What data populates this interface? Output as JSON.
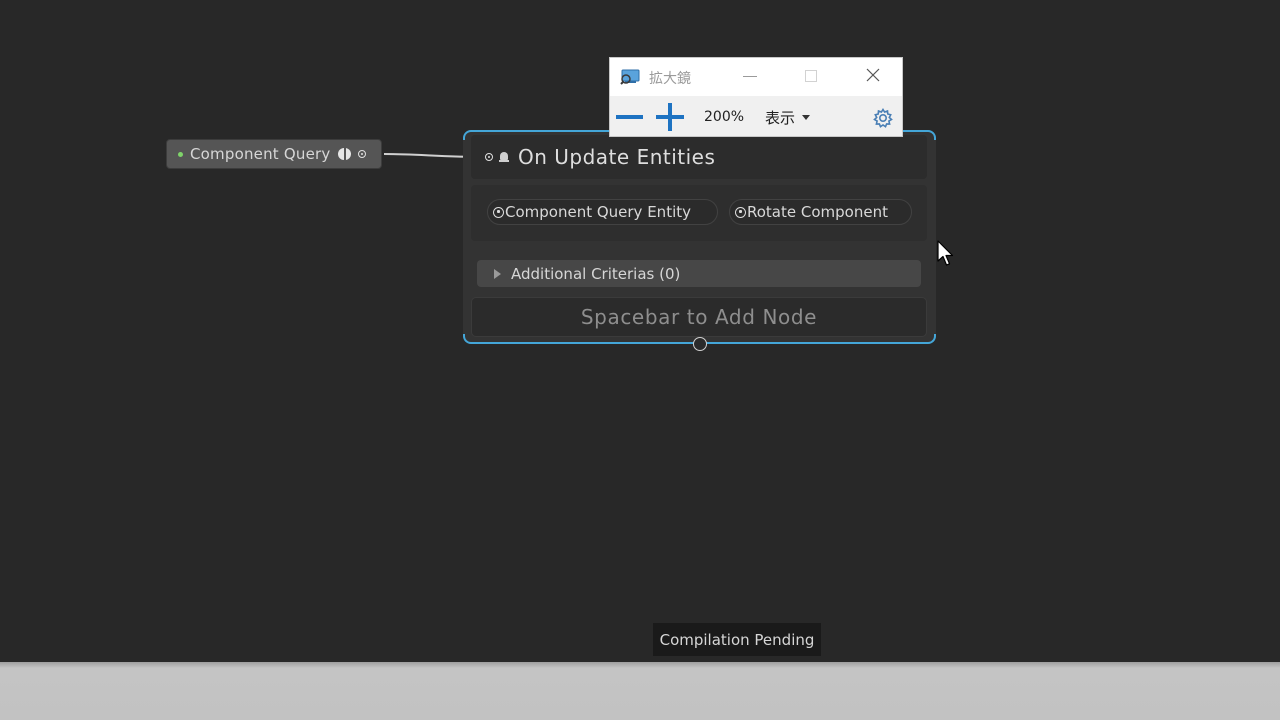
{
  "graph": {
    "variable_node": {
      "label": "Component Query"
    },
    "event_node": {
      "title": "On Update Entities",
      "fields": [
        {
          "label": "Component Query Entity"
        },
        {
          "label": "Rotate Component"
        }
      ],
      "additional_criterias": "Additional Criterias (0)",
      "add_node_hint": "Spacebar to Add Node"
    }
  },
  "magnifier": {
    "title": "拡大鏡",
    "zoom_level": "200%",
    "view_label": "表示"
  },
  "status": {
    "text": "Compilation Pending"
  },
  "colors": {
    "canvas": "#282828",
    "node_selection": "#44a6d8",
    "magnifier_accent": "#1e73c2",
    "variable_dot": "#7fd46a"
  }
}
